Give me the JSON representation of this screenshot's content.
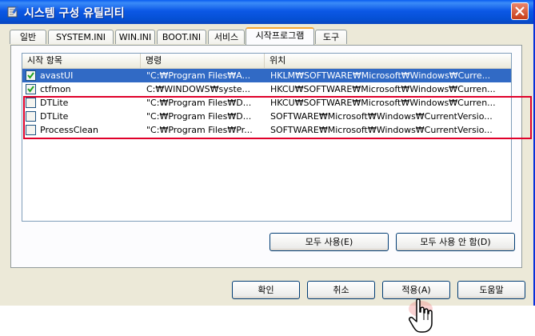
{
  "window": {
    "title": "시스템 구성 유틸리티"
  },
  "tabs": [
    {
      "label": "일반"
    },
    {
      "label": "SYSTEM.INI"
    },
    {
      "label": "WIN.INI"
    },
    {
      "label": "BOOT.INI"
    },
    {
      "label": "서비스"
    },
    {
      "label": "시작프로그램",
      "active": true
    },
    {
      "label": "도구"
    }
  ],
  "startup_list": {
    "columns": [
      "시작 항목",
      "명령",
      "위치"
    ],
    "rows": [
      {
        "checked": true,
        "selected": true,
        "item": "avastUI",
        "command": "\"C:₩Program Files₩A...",
        "location": "HKLM₩SOFTWARE₩Microsoft₩Windows₩Curre..."
      },
      {
        "checked": true,
        "selected": false,
        "item": "ctfmon",
        "command": "C:₩WINDOWS₩syste...",
        "location": "HKCU₩SOFTWARE₩Microsoft₩Windows₩Curren..."
      },
      {
        "checked": false,
        "selected": false,
        "item": "DTLite",
        "command": "\"C:₩Program Files₩D...",
        "location": "HKCU₩SOFTWARE₩Microsoft₩Windows₩Curren..."
      },
      {
        "checked": false,
        "selected": false,
        "item": "DTLite",
        "command": "\"C:₩Program Files₩D...",
        "location": "SOFTWARE₩Microsoft₩Windows₩CurrentVersio..."
      },
      {
        "checked": false,
        "selected": false,
        "item": "ProcessClean",
        "command": "\"C:₩Program Files₩Pr...",
        "location": "SOFTWARE₩Microsoft₩Windows₩CurrentVersio..."
      }
    ]
  },
  "buttons": {
    "enable_all": "모두 사용(E)",
    "disable_all": "모두 사용 안 함(D)",
    "ok": "확인",
    "cancel": "취소",
    "apply": "적용(A)",
    "help": "도움말"
  },
  "colors": {
    "accent": "#0a5df0",
    "selection": "#316ac5",
    "highlight_box": "#e0002a",
    "tab_active_top": "#f6a733"
  }
}
